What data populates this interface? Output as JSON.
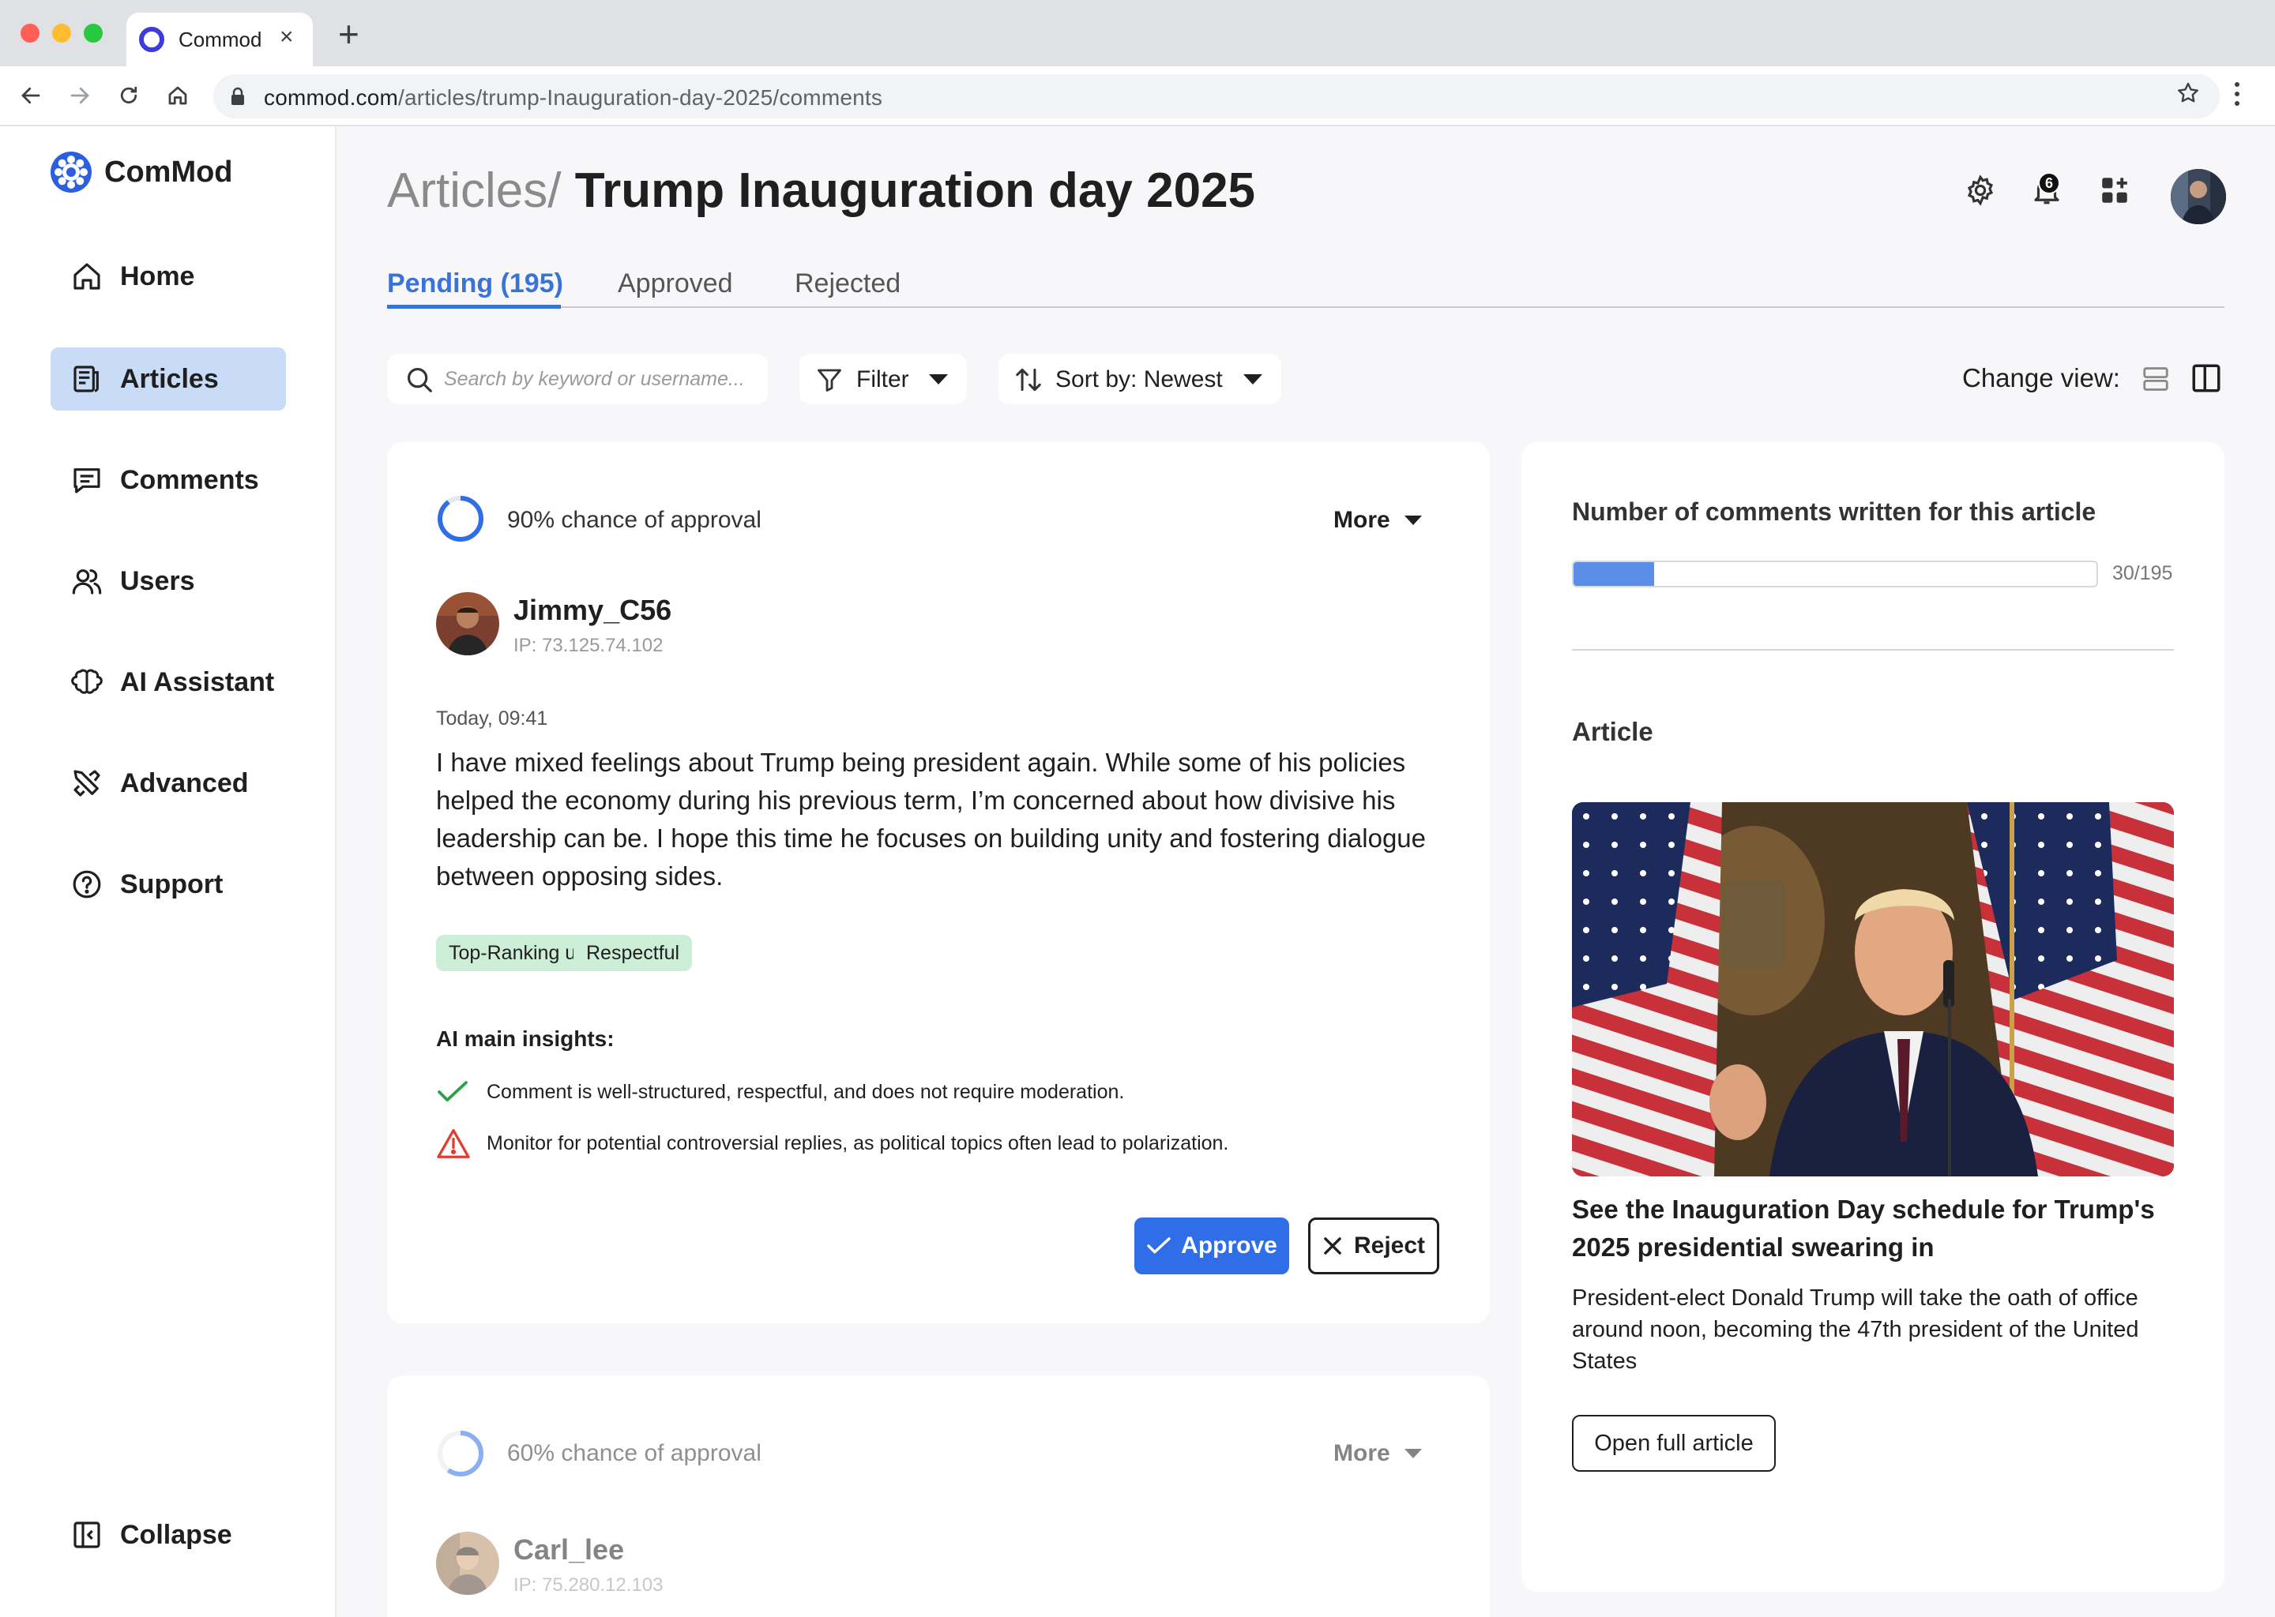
{
  "browser": {
    "tab_title": "Commod",
    "url_host": "commod.com",
    "url_path": "/articles/trump-Inauguration-day-2025/comments"
  },
  "sidebar": {
    "brand": "ComMod",
    "items": [
      {
        "label": "Home",
        "icon": "home-icon"
      },
      {
        "label": "Articles",
        "icon": "article-icon",
        "active": true
      },
      {
        "label": "Comments",
        "icon": "comment-icon"
      },
      {
        "label": "Users",
        "icon": "users-icon"
      },
      {
        "label": "AI Assistant",
        "icon": "brain-icon"
      },
      {
        "label": "Advanced",
        "icon": "tools-icon"
      },
      {
        "label": "Support",
        "icon": "help-icon"
      }
    ],
    "collapse_label": "Collapse"
  },
  "header": {
    "crumb": "Articles/",
    "title": "Trump Inauguration day 2025",
    "notification_count": "6"
  },
  "tabs": [
    {
      "label": "Pending (195)",
      "active": true
    },
    {
      "label": "Approved"
    },
    {
      "label": "Rejected"
    }
  ],
  "controls": {
    "search_placeholder": "Search by keyword or username...",
    "filter_label": "Filter",
    "sort_label": "Sort by: Newest",
    "change_view_label": "Change view:"
  },
  "comments": [
    {
      "approval_chance": 0.9,
      "approval_text": "90% chance of approval",
      "more_label": "More",
      "username": "Jimmy_C56",
      "ip": "IP: 73.125.74.102",
      "time": "Today, 09:41",
      "body": "I have mixed feelings about Trump being president again. While some of his policies helped the economy during his previous term, I’m concerned about how divisive his leadership can be. I hope this time he focuses on building unity and fostering dialogue between opposing sides.",
      "tags": [
        "Top-Ranking user",
        "Respectful"
      ],
      "ai_heading": "AI main insights:",
      "insights": [
        {
          "type": "ok",
          "icon": "check-icon",
          "text": "Comment is well-structured, respectful, and does not require moderation."
        },
        {
          "type": "warn",
          "icon": "warning-icon",
          "text": "Monitor for potential controversial replies, as political topics often lead to polarization."
        }
      ],
      "approve_label": "Approve",
      "reject_label": "Reject"
    },
    {
      "approval_chance": 0.6,
      "approval_text": "60% chance of approval",
      "more_label": "More",
      "username": "Carl_lee",
      "ip": "IP: 75.280.12.103"
    }
  ],
  "panel": {
    "count_title": "Number of comments written for this article",
    "count_value": 30,
    "count_total": 195,
    "count_label": "30/195",
    "article_heading": "Article",
    "headline": "See the Inauguration Day schedule for Trump's 2025 presidential swearing in",
    "description": "President-elect Donald Trump will take the oath of office around noon, becoming the 47th president of the United States",
    "open_label": "Open full article"
  },
  "colors": {
    "accent": "#3a73d6",
    "approve": "#2f6ee6",
    "active_nav": "#c9dcf7",
    "tag_bg": "#cdeed6",
    "ok": "#27a344",
    "warn": "#e23b30"
  }
}
